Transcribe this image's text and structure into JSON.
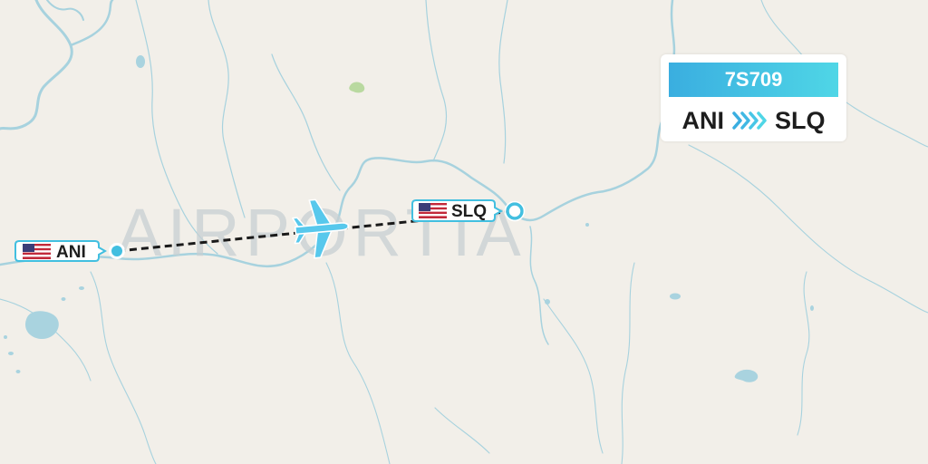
{
  "map": {
    "watermark": "AIRPORTIA",
    "colors": {
      "land": "#f2efe9",
      "water": "#a9d3df",
      "river": "#9fcfdc",
      "route": "#1a1a1a",
      "accent": "#42bfe0",
      "park": "#b9d9a0"
    }
  },
  "airports": {
    "origin": {
      "code": "ANI",
      "flag": "us-flag-icon"
    },
    "destination": {
      "code": "SLQ",
      "flag": "us-flag-icon"
    }
  },
  "route_card": {
    "flight_number": "7S709",
    "origin": "ANI",
    "destination": "SLQ",
    "arrow_icon": "chevrons-right-icon"
  }
}
